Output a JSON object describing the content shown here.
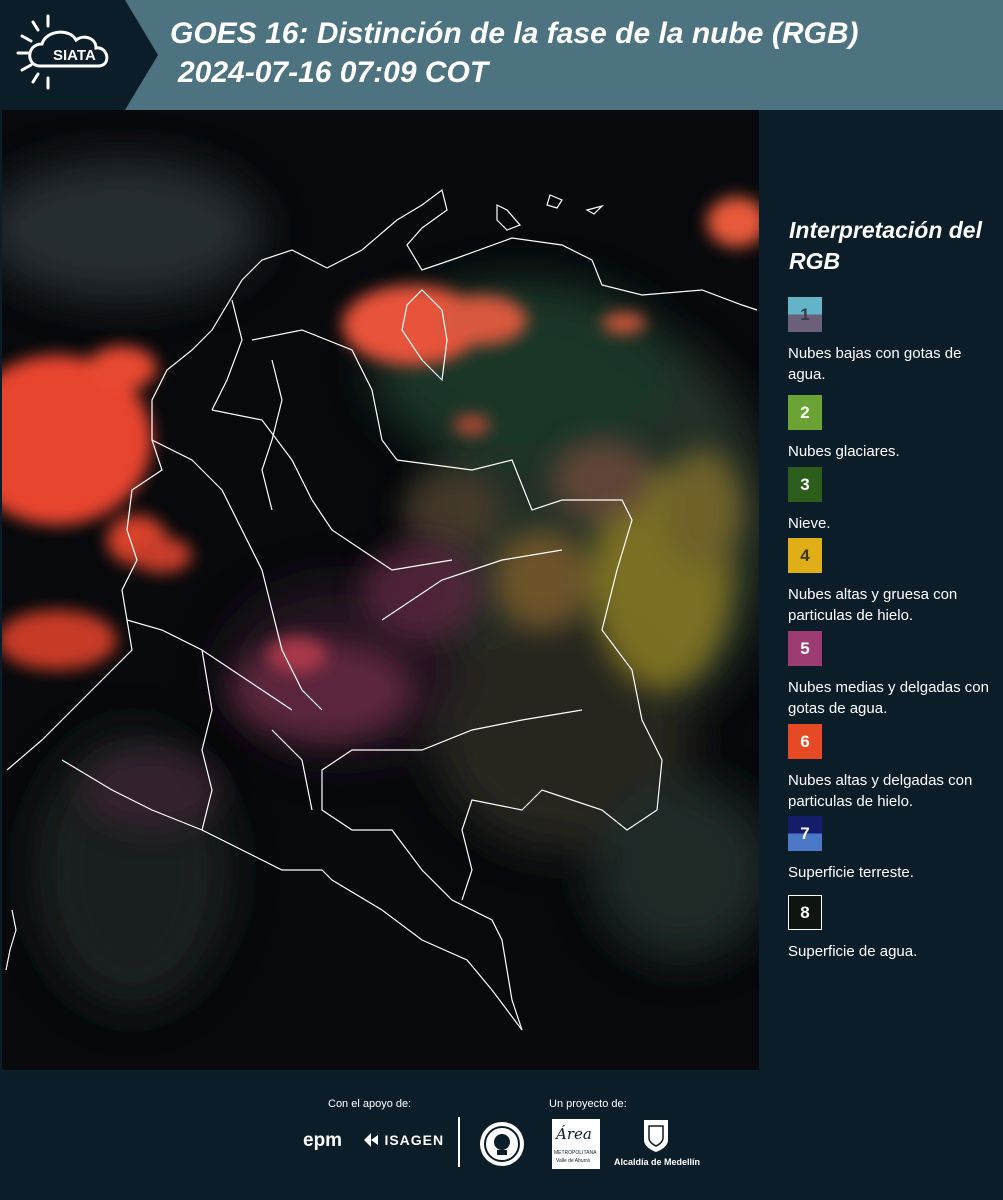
{
  "header": {
    "logo_text": "SIATA",
    "title_line1": "GOES 16: Distinción de la fase de la nube (RGB)",
    "title_line2": "2024-07-16 07:09 COT"
  },
  "legend": {
    "title": "Interpretación del RGB",
    "items": [
      {
        "number": "1",
        "label": "Nubes bajas con gotas de agua.",
        "color_top": "#63b4c6",
        "color_bottom": "#6b607a"
      },
      {
        "number": "2",
        "label": "Nubes glaciares.",
        "color_top": "#6aa234",
        "color_bottom": "#6aa234"
      },
      {
        "number": "3",
        "label": "Nieve.",
        "color_top": "#2d5d1d",
        "color_bottom": "#2d5d1d"
      },
      {
        "number": "4",
        "label": "Nubes altas y gruesa con particulas de hielo.",
        "color_top": "#e0ae16",
        "color_bottom": "#e0ae16"
      },
      {
        "number": "5",
        "label": "Nubes medias y delgadas con gotas de agua.",
        "color_top": "#9d3c72",
        "color_bottom": "#9d3c72"
      },
      {
        "number": "6",
        "label": "Nubes altas y delgadas con particulas de hielo.",
        "color_top": "#e54a25",
        "color_bottom": "#e54a25"
      },
      {
        "number": "7",
        "label": "Superficie terreste.",
        "color_top": "#131d6a",
        "color_bottom": "#4a78c6"
      },
      {
        "number": "8",
        "label": "Superficie de agua.",
        "color_top": "#0e1410",
        "color_bottom": "#0e1410"
      }
    ]
  },
  "footer": {
    "support_label": "Con el apoyo de:",
    "project_label": "Un proyecto de:",
    "logo_epm": "epm",
    "logo_isagen": "ISAGEN",
    "logo_area": "Área",
    "logo_area_sub": "METROPOLITANA",
    "logo_area_sub2": "Valle de Aburrá",
    "logo_alcaldia": "Alcaldía de Medellín"
  }
}
